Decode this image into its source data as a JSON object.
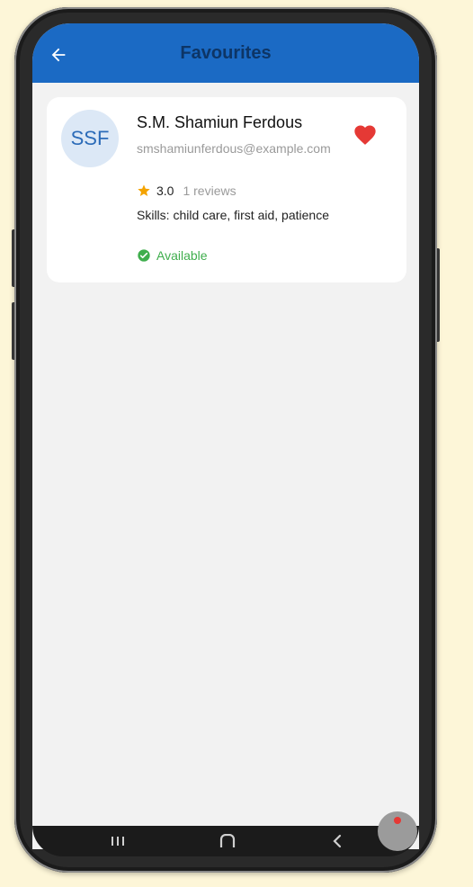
{
  "app_bar": {
    "title": "Favourites",
    "background_color": "#1b6ac4",
    "back_icon": "arrow-left-icon"
  },
  "favourites": [
    {
      "initials": "SSF",
      "name": "S.M. Shamiun Ferdous",
      "email": "smshamiunferdous@example.com",
      "rating": "3.0",
      "reviews": "1 reviews",
      "skills": "Skills: child care, first aid, patience",
      "status": "Available",
      "favourite": true,
      "heart_color": "#e53935",
      "star_color": "#f4a300",
      "status_color": "#3fae4d"
    }
  ],
  "nav_bar": {
    "items": [
      "recent-apps-icon",
      "home-icon",
      "back-icon"
    ]
  }
}
